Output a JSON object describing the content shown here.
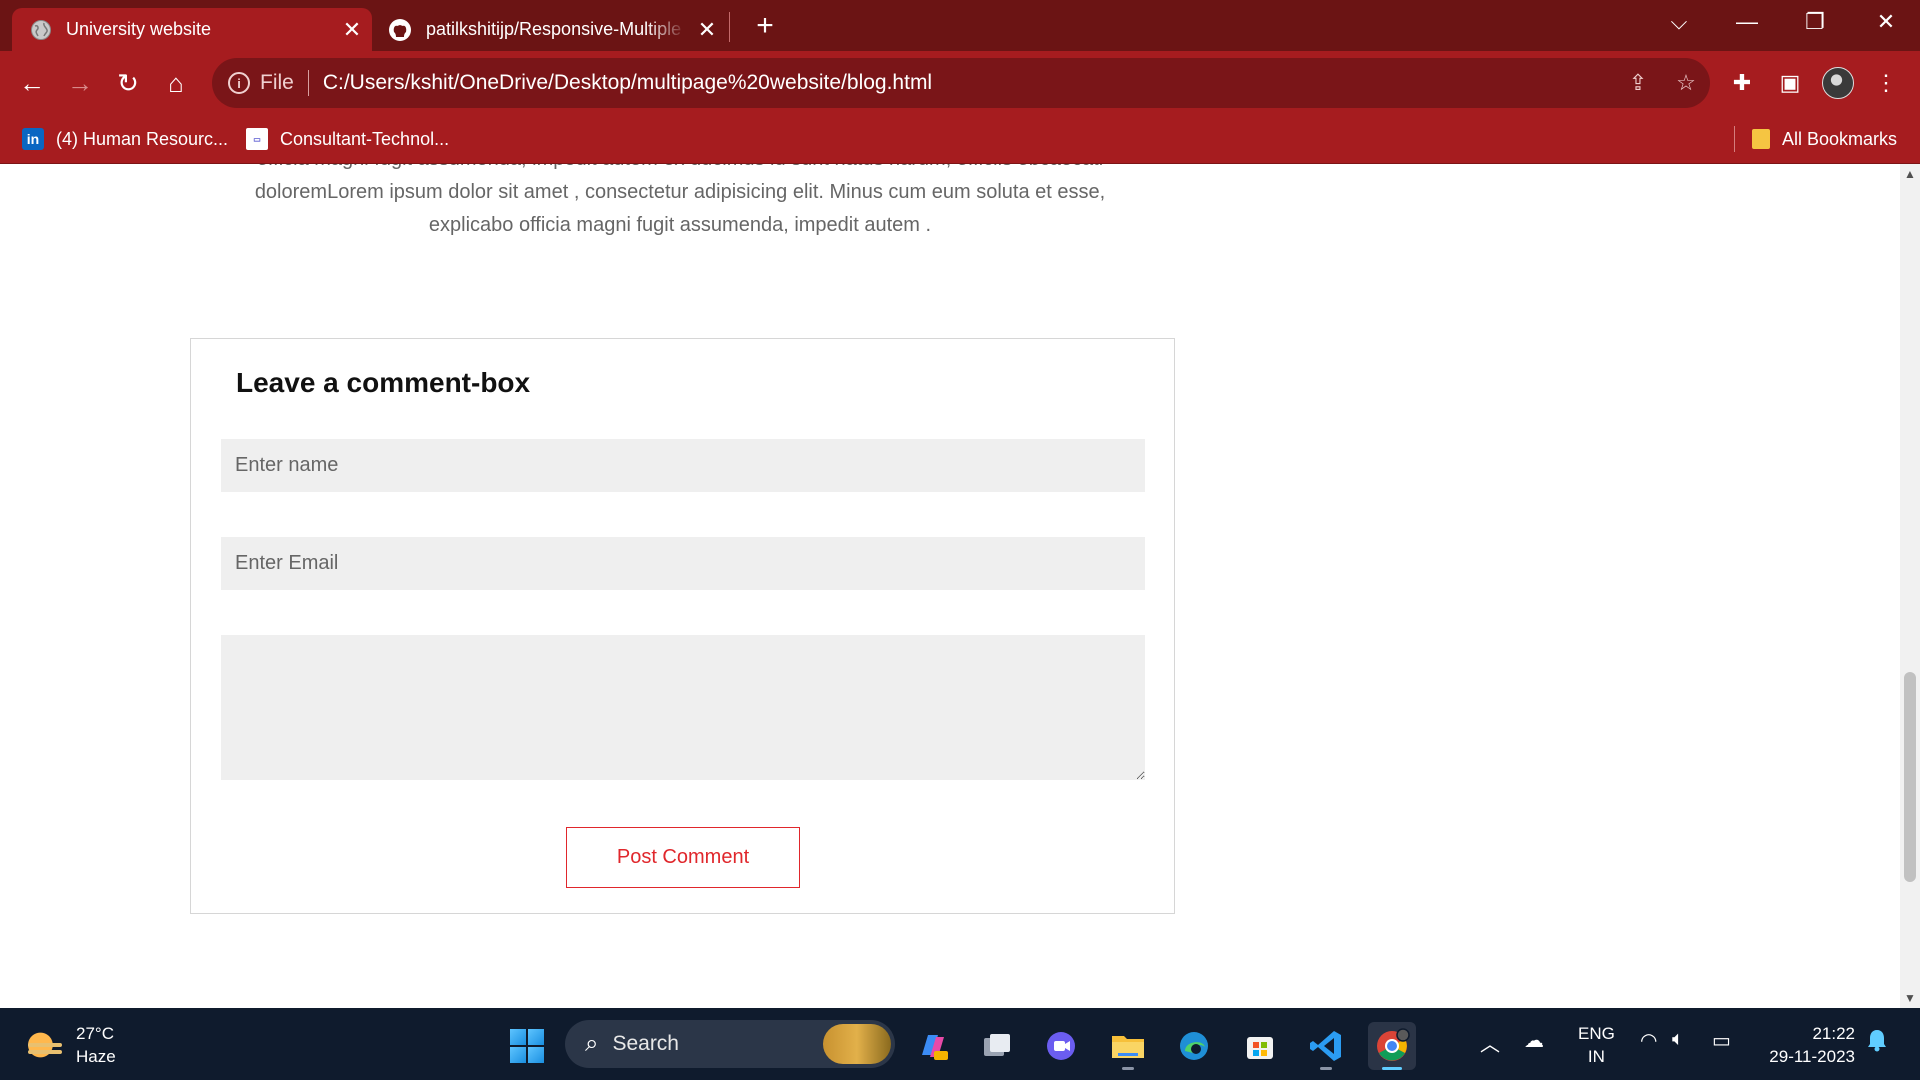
{
  "browser": {
    "tabs": [
      {
        "title": "University website",
        "active": true,
        "icon": "globe-icon"
      },
      {
        "title": "patilkshitijp/Responsive-Multiple",
        "active": false,
        "icon": "github-icon"
      }
    ],
    "address": {
      "scheme": "File",
      "url": "C:/Users/kshit/OneDrive/Desktop/multipage%20website/blog.html"
    },
    "bookmarks": [
      {
        "label": "(4) Human Resourc...",
        "icon": "linkedin-icon"
      },
      {
        "label": "Consultant-Technol...",
        "icon": "consultant-icon"
      }
    ],
    "all_bookmarks": "All Bookmarks",
    "accent_color": "#a61c1f"
  },
  "page": {
    "paragraph": "officia magni fugit assumenda, impedit autem ex ducimus id sunt natus harum, officiis obcaecati doloremLorem ipsum dolor sit amet , consectetur adipisicing elit. Minus cum eum soluta et esse, explicabo officia magni fugit assumenda, impedit autem .",
    "comment_box": {
      "title": "Leave a comment-box",
      "name_placeholder": "Enter name",
      "email_placeholder": "Enter Email",
      "message_value": "",
      "button_label": "Post Comment",
      "button_color": "#e0272c"
    }
  },
  "taskbar": {
    "weather": {
      "temp": "27°C",
      "condition": "Haze"
    },
    "search_label": "Search",
    "language": {
      "line1": "ENG",
      "line2": "IN"
    },
    "time": "21:22",
    "date": "29-11-2023"
  }
}
